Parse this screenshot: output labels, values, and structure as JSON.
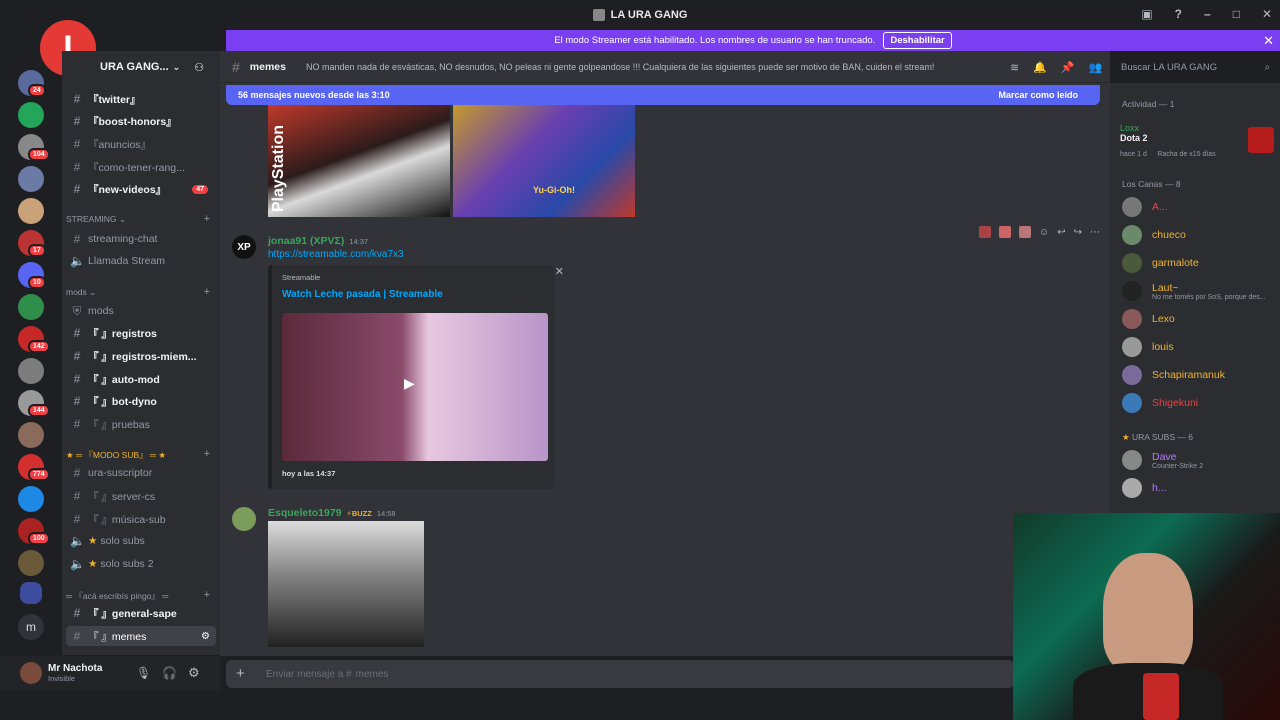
{
  "window": {
    "title": "LA URA GANG"
  },
  "banner": {
    "text": "El modo Streamer está habilitado. Los nombres de usuario se han truncado.",
    "button": "Deshabilitar"
  },
  "watermark": {
    "text": "I"
  },
  "server": {
    "name": "URA GANG..."
  },
  "rail_badges": [
    "24",
    "104",
    "17",
    "10",
    "142",
    "144",
    "774",
    "100"
  ],
  "channels": [
    {
      "name": "『twitter』",
      "bold": true
    },
    {
      "name": "『boost-honors』",
      "bold": true
    },
    {
      "name": "『anuncios』",
      "bold": false
    },
    {
      "name": "『como-tener-rang...",
      "bold": false
    },
    {
      "name": "『new-videos』",
      "bold": true,
      "badge": "47"
    }
  ],
  "streaming": {
    "category": "STREAMING",
    "items": [
      {
        "name": "streaming-chat"
      },
      {
        "name": "Llamada Stream"
      }
    ]
  },
  "mods": {
    "category": "mods",
    "items": [
      {
        "name": "mods",
        "bold": false
      },
      {
        "name": "『 』registros",
        "bold": true
      },
      {
        "name": "『 』registros-miem...",
        "bold": true
      },
      {
        "name": "『 』auto-mod",
        "bold": true
      },
      {
        "name": "『 』bot-dyno",
        "bold": true
      },
      {
        "name": "『 』pruebas",
        "bold": false
      }
    ]
  },
  "modosub": {
    "category": "『MODO SUB』",
    "items": [
      {
        "name": "ura-suscriptor"
      },
      {
        "name": "『 』server-cs"
      },
      {
        "name": "『 』música-sub"
      },
      {
        "name": "solo subs"
      },
      {
        "name": "solo subs 2"
      }
    ]
  },
  "pingo": {
    "category": "『acá escribís pingo』",
    "items": [
      {
        "name": "『 』general-sape",
        "active": false
      },
      {
        "name": "『 』memes",
        "active": true
      }
    ]
  },
  "user": {
    "name": "Mr Nachota",
    "status": "Invisible"
  },
  "header": {
    "channel": "memes",
    "topic": "NO manden nada de esvásticas, NO desnudos, NO peleas ni gente golpeandose !!! Cualquiera de las siguientes puede ser motivo de BAN, cuiden el stream!",
    "search_placeholder": "Buscar LA URA GANG"
  },
  "new_messages": {
    "text": "56 mensajes nuevos desde las 3:10",
    "mark": "Marcar como leído"
  },
  "images_top": {
    "left_label": "PlayStation",
    "right_label": "Yu-Gi-Oh!"
  },
  "messages": [
    {
      "author": "jonaa91 (XPVΣ)",
      "time": "14:37",
      "link": "https://streamable.com/kva7x3",
      "embed": {
        "provider": "Streamable",
        "title": "Watch Leche pasada | Streamable",
        "footer": "hoy a las 14:37"
      }
    },
    {
      "author": "Esqueleto1979",
      "tag": "⚡BUZZ",
      "time": "14:58"
    }
  ],
  "input": {
    "placeholder": "Enviar mensaje a #",
    "channel": "memes"
  },
  "members": {
    "activity_header": "Actividad — 1",
    "activity": {
      "name": "Loxx",
      "game": "Dota 2",
      "detail": "hace 1 d",
      "streak": "Racha de x15 días"
    },
    "groups": [
      {
        "title": "Los Canas — 8",
        "members": [
          {
            "name": "A...",
            "color": "#f23f43",
            "sub": ""
          },
          {
            "name": "chueco",
            "color": "#f0b232",
            "sub": ""
          },
          {
            "name": "garmalote",
            "color": "#f0b232",
            "sub": ""
          },
          {
            "name": "Laut~",
            "color": "#f0b232",
            "sub": "No me tomés por SoS, porque des..."
          },
          {
            "name": "Lexo",
            "color": "#f0b232",
            "sub": ""
          },
          {
            "name": "louis",
            "color": "#f0b232",
            "sub": ""
          },
          {
            "name": "Schapiramanuk",
            "color": "#f0b232",
            "sub": ""
          },
          {
            "name": "Shigekuni",
            "color": "#f23f43",
            "sub": ""
          }
        ]
      },
      {
        "title": "URA SUBS — 6",
        "members": [
          {
            "name": "Dave",
            "color": "#b47aff",
            "sub": "Counter-Strike 2"
          },
          {
            "name": "h...",
            "color": "#b47aff",
            "sub": ""
          }
        ]
      }
    ]
  },
  "colors": {
    "accent": "#5865f2",
    "banner": "#7b3ff2",
    "green_name": "#3ba55d",
    "link": "#00a8fc"
  }
}
